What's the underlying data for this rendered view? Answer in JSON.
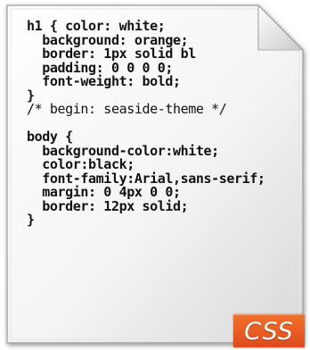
{
  "code_lines": [
    "h1 { color: white;",
    "  background: orange;",
    "  border: 1px solid bl",
    "  padding: 0 0 0 0;",
    "  font-weight: bold;",
    "}",
    "/* begin: seaside-theme */",
    "",
    "body {",
    "  background-color:white;",
    "  color:black;",
    "  font-family:Arial,sans-serif;",
    "  margin: 0 4px 0 0;",
    "  border: 12px solid;",
    "}"
  ],
  "badge": {
    "label": "CSS",
    "color": "#e85a22"
  },
  "document_icon": "file-icon"
}
